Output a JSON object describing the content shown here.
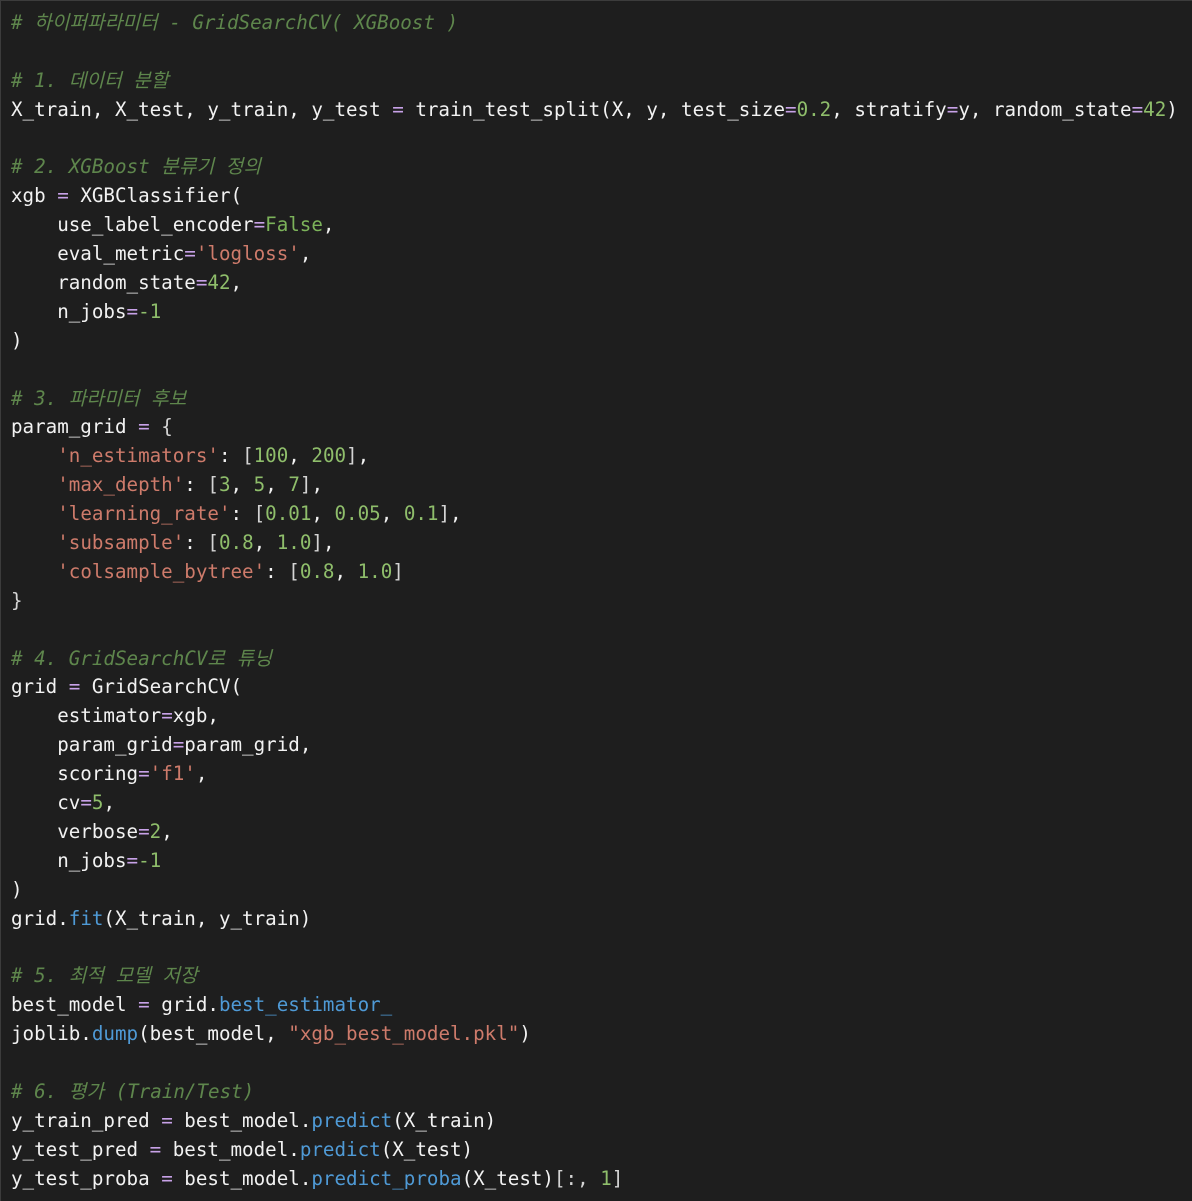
{
  "editor": {
    "lines": [
      [
        {
          "t": "comment",
          "v": "# 하이퍼파라미터 - GridSearchCV( XGBoost )"
        }
      ],
      [],
      [
        {
          "t": "comment",
          "v": "# 1. 데이터 분할"
        }
      ],
      [
        {
          "t": "plain",
          "v": "X_train, X_test, y_train, y_test "
        },
        {
          "t": "operator",
          "v": "="
        },
        {
          "t": "plain",
          "v": " train_test_split(X, y, test_size"
        },
        {
          "t": "operator",
          "v": "="
        },
        {
          "t": "number",
          "v": "0.2"
        },
        {
          "t": "plain",
          "v": ", stratify"
        },
        {
          "t": "operator",
          "v": "="
        },
        {
          "t": "plain",
          "v": "y, random_state"
        },
        {
          "t": "operator",
          "v": "="
        },
        {
          "t": "number",
          "v": "42"
        },
        {
          "t": "plain",
          "v": ")"
        }
      ],
      [],
      [
        {
          "t": "comment",
          "v": "# 2. XGBoost 분류기 정의"
        }
      ],
      [
        {
          "t": "plain",
          "v": "xgb "
        },
        {
          "t": "operator",
          "v": "="
        },
        {
          "t": "plain",
          "v": " XGBClassifier("
        }
      ],
      [
        {
          "t": "plain",
          "v": "    use_label_encoder"
        },
        {
          "t": "operator",
          "v": "="
        },
        {
          "t": "keyword",
          "v": "False"
        },
        {
          "t": "plain",
          "v": ","
        }
      ],
      [
        {
          "t": "plain",
          "v": "    eval_metric"
        },
        {
          "t": "operator",
          "v": "="
        },
        {
          "t": "string",
          "v": "'logloss'"
        },
        {
          "t": "plain",
          "v": ","
        }
      ],
      [
        {
          "t": "plain",
          "v": "    random_state"
        },
        {
          "t": "operator",
          "v": "="
        },
        {
          "t": "number",
          "v": "42"
        },
        {
          "t": "plain",
          "v": ","
        }
      ],
      [
        {
          "t": "plain",
          "v": "    n_jobs"
        },
        {
          "t": "operator",
          "v": "="
        },
        {
          "t": "number",
          "v": "-1"
        }
      ],
      [
        {
          "t": "plain",
          "v": ")"
        }
      ],
      [],
      [
        {
          "t": "comment",
          "v": "# 3. 파라미터 후보"
        }
      ],
      [
        {
          "t": "plain",
          "v": "param_grid "
        },
        {
          "t": "operator",
          "v": "="
        },
        {
          "t": "plain",
          "v": " "
        },
        {
          "t": "bracket",
          "v": "{"
        }
      ],
      [
        {
          "t": "plain",
          "v": "    "
        },
        {
          "t": "string",
          "v": "'n_estimators'"
        },
        {
          "t": "plain",
          "v": ": "
        },
        {
          "t": "bracket",
          "v": "["
        },
        {
          "t": "number",
          "v": "100"
        },
        {
          "t": "plain",
          "v": ", "
        },
        {
          "t": "number",
          "v": "200"
        },
        {
          "t": "bracket",
          "v": "]"
        },
        {
          "t": "plain",
          "v": ","
        }
      ],
      [
        {
          "t": "plain",
          "v": "    "
        },
        {
          "t": "string",
          "v": "'max_depth'"
        },
        {
          "t": "plain",
          "v": ": "
        },
        {
          "t": "bracket",
          "v": "["
        },
        {
          "t": "number",
          "v": "3"
        },
        {
          "t": "plain",
          "v": ", "
        },
        {
          "t": "number",
          "v": "5"
        },
        {
          "t": "plain",
          "v": ", "
        },
        {
          "t": "number",
          "v": "7"
        },
        {
          "t": "bracket",
          "v": "]"
        },
        {
          "t": "plain",
          "v": ","
        }
      ],
      [
        {
          "t": "plain",
          "v": "    "
        },
        {
          "t": "string",
          "v": "'learning_rate'"
        },
        {
          "t": "plain",
          "v": ": "
        },
        {
          "t": "bracket",
          "v": "["
        },
        {
          "t": "number",
          "v": "0.01"
        },
        {
          "t": "plain",
          "v": ", "
        },
        {
          "t": "number",
          "v": "0.05"
        },
        {
          "t": "plain",
          "v": ", "
        },
        {
          "t": "number",
          "v": "0.1"
        },
        {
          "t": "bracket",
          "v": "]"
        },
        {
          "t": "plain",
          "v": ","
        }
      ],
      [
        {
          "t": "plain",
          "v": "    "
        },
        {
          "t": "string",
          "v": "'subsample'"
        },
        {
          "t": "plain",
          "v": ": "
        },
        {
          "t": "bracket",
          "v": "["
        },
        {
          "t": "number",
          "v": "0.8"
        },
        {
          "t": "plain",
          "v": ", "
        },
        {
          "t": "number",
          "v": "1.0"
        },
        {
          "t": "bracket",
          "v": "]"
        },
        {
          "t": "plain",
          "v": ","
        }
      ],
      [
        {
          "t": "plain",
          "v": "    "
        },
        {
          "t": "string",
          "v": "'colsample_bytree'"
        },
        {
          "t": "plain",
          "v": ": "
        },
        {
          "t": "bracket",
          "v": "["
        },
        {
          "t": "number",
          "v": "0.8"
        },
        {
          "t": "plain",
          "v": ", "
        },
        {
          "t": "number",
          "v": "1.0"
        },
        {
          "t": "bracket",
          "v": "]"
        }
      ],
      [
        {
          "t": "bracket",
          "v": "}"
        }
      ],
      [],
      [
        {
          "t": "comment",
          "v": "# 4. GridSearchCV로 튜닝"
        }
      ],
      [
        {
          "t": "plain",
          "v": "grid "
        },
        {
          "t": "operator",
          "v": "="
        },
        {
          "t": "plain",
          "v": " GridSearchCV("
        }
      ],
      [
        {
          "t": "plain",
          "v": "    estimator"
        },
        {
          "t": "operator",
          "v": "="
        },
        {
          "t": "plain",
          "v": "xgb,"
        }
      ],
      [
        {
          "t": "plain",
          "v": "    param_grid"
        },
        {
          "t": "operator",
          "v": "="
        },
        {
          "t": "plain",
          "v": "param_grid,"
        }
      ],
      [
        {
          "t": "plain",
          "v": "    scoring"
        },
        {
          "t": "operator",
          "v": "="
        },
        {
          "t": "string",
          "v": "'f1'"
        },
        {
          "t": "plain",
          "v": ","
        }
      ],
      [
        {
          "t": "plain",
          "v": "    cv"
        },
        {
          "t": "operator",
          "v": "="
        },
        {
          "t": "number",
          "v": "5"
        },
        {
          "t": "plain",
          "v": ","
        }
      ],
      [
        {
          "t": "plain",
          "v": "    verbose"
        },
        {
          "t": "operator",
          "v": "="
        },
        {
          "t": "number",
          "v": "2"
        },
        {
          "t": "plain",
          "v": ","
        }
      ],
      [
        {
          "t": "plain",
          "v": "    n_jobs"
        },
        {
          "t": "operator",
          "v": "="
        },
        {
          "t": "number",
          "v": "-1"
        }
      ],
      [
        {
          "t": "plain",
          "v": ")"
        }
      ],
      [
        {
          "t": "plain",
          "v": "grid."
        },
        {
          "t": "method",
          "v": "fit"
        },
        {
          "t": "plain",
          "v": "(X_train, y_train)"
        }
      ],
      [],
      [
        {
          "t": "comment",
          "v": "# 5. 최적 모델 저장"
        }
      ],
      [
        {
          "t": "plain",
          "v": "best_model "
        },
        {
          "t": "operator",
          "v": "="
        },
        {
          "t": "plain",
          "v": " grid."
        },
        {
          "t": "method",
          "v": "best_estimator_"
        }
      ],
      [
        {
          "t": "plain",
          "v": "joblib."
        },
        {
          "t": "method",
          "v": "dump"
        },
        {
          "t": "plain",
          "v": "(best_model, "
        },
        {
          "t": "string",
          "v": "\"xgb_best_model.pkl\""
        },
        {
          "t": "plain",
          "v": ")"
        }
      ],
      [],
      [
        {
          "t": "comment",
          "v": "# 6. 평가 (Train/Test)"
        }
      ],
      [
        {
          "t": "plain",
          "v": "y_train_pred "
        },
        {
          "t": "operator",
          "v": "="
        },
        {
          "t": "plain",
          "v": " best_model."
        },
        {
          "t": "method",
          "v": "predict"
        },
        {
          "t": "plain",
          "v": "(X_train)"
        }
      ],
      [
        {
          "t": "plain",
          "v": "y_test_pred "
        },
        {
          "t": "operator",
          "v": "="
        },
        {
          "t": "plain",
          "v": " best_model."
        },
        {
          "t": "method",
          "v": "predict"
        },
        {
          "t": "plain",
          "v": "(X_test)"
        }
      ],
      [
        {
          "t": "plain",
          "v": "y_test_proba "
        },
        {
          "t": "operator",
          "v": "="
        },
        {
          "t": "plain",
          "v": " best_model."
        },
        {
          "t": "method",
          "v": "predict_proba"
        },
        {
          "t": "plain",
          "v": "(X_test)"
        },
        {
          "t": "bracket",
          "v": "[:, "
        },
        {
          "t": "number",
          "v": "1"
        },
        {
          "t": "bracket",
          "v": "]"
        }
      ]
    ]
  },
  "colors": {
    "background": "#1e1e1e",
    "comment": "#6a9955",
    "plain": "#f2f2f2",
    "number": "#8fbe6b",
    "string": "#ce7b6b",
    "keyword": "#7cb35a",
    "method": "#4f9ad6",
    "operator": "#c8a2e8"
  }
}
